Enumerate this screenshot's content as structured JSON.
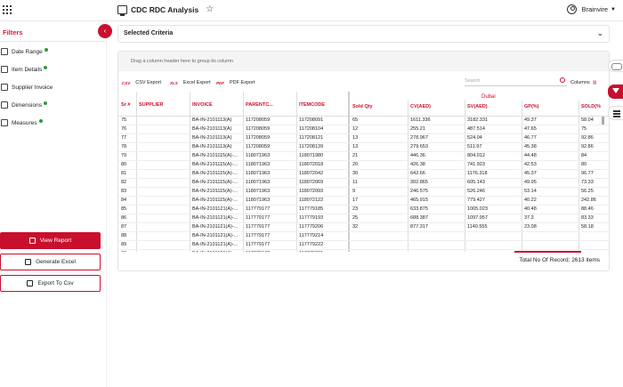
{
  "app": {
    "title": "CDC RDC Analysis",
    "user": "Brainvire"
  },
  "sidebar": {
    "title": "Filters",
    "items": [
      {
        "label": "Date Range",
        "dot": true
      },
      {
        "label": "Item Details",
        "dot": true
      },
      {
        "label": "Supplier Invoice",
        "dot": false
      },
      {
        "label": "Dimensions",
        "dot": true
      },
      {
        "label": "Measures",
        "dot": true
      }
    ],
    "view_report": "View Report",
    "generate_excel": "Generate Excel",
    "export_csv": "Export To Csv"
  },
  "criteria": {
    "label": "Selected Criteria"
  },
  "grid": {
    "group_hint": "Drag a column header here to group its column",
    "csv_export": "CSV Export",
    "excel_export": "Excel Export",
    "pdf_export": "PDF Export",
    "csv_fmt": "CSV",
    "xls_fmt": "XLS",
    "pdf_fmt": "PDF",
    "search_placeholder": "Search",
    "columns_label": "Columns",
    "group_header": "Dubai",
    "headers": [
      "Sr #",
      "SUPPLIER",
      "INVOICE",
      "PARENTC...",
      "ITEMCODE",
      "Sold Qty",
      "CV(AED)",
      "SV(AED)",
      "GP(%)",
      "SOLD(%"
    ],
    "rows": [
      [
        "75",
        "",
        "BA-IN-2101113(A)",
        "117208059",
        "117208091",
        "65",
        "1611.336",
        "3182.331",
        "49.37",
        "58.04"
      ],
      [
        "76",
        "",
        "BA-IN-2101113(A)",
        "117208059",
        "117208104",
        "12",
        "255.21",
        "487.514",
        "47.65",
        "75"
      ],
      [
        "77",
        "",
        "BA-IN-2101113(A)",
        "117208059",
        "117208121",
        "13",
        "278.967",
        "524.04",
        "46.77",
        "92.86"
      ],
      [
        "78",
        "",
        "BA-IN-2101113(A)",
        "117208059",
        "117208139",
        "13",
        "279.653",
        "511.97",
        "45.38",
        "92.86"
      ],
      [
        "79",
        "",
        "BA-IN-2101115(A)-...",
        "118071963",
        "118071980",
        "21",
        "446.36",
        "804.012",
        "44.48",
        "84"
      ],
      [
        "80",
        "",
        "BA-IN-2101115(A)-...",
        "118071963",
        "118072018",
        "20",
        "426.38",
        "741.923",
        "42.53",
        "80"
      ],
      [
        "81",
        "",
        "BA-IN-2101115(A)-...",
        "118071963",
        "118072042",
        "30",
        "642.66",
        "1176.318",
        "45.37",
        "96.77"
      ],
      [
        "82",
        "",
        "BA-IN-2101115(A)-...",
        "118071963",
        "118072069",
        "11",
        "302.865",
        "605.143",
        "49.95",
        "73.33"
      ],
      [
        "83",
        "",
        "BA-IN-2101115(A)-...",
        "118071963",
        "118072093",
        "9",
        "246.575",
        "526.246",
        "53.14",
        "56.25"
      ],
      [
        "84",
        "",
        "BA-IN-2101115(A)-...",
        "118071963",
        "118072122",
        "17",
        "465.915",
        "779.427",
        "40.22",
        "242.86"
      ],
      [
        "85",
        "",
        "BA-IN-2101121(A)-...",
        "117779177",
        "117779185",
        "23",
        "633.875",
        "1065.023",
        "40.48",
        "88.46"
      ],
      [
        "86",
        "",
        "BA-IN-2101121(A)-...",
        "117779177",
        "117779193",
        "25",
        "688.387",
        "1097.957",
        "37.3",
        "83.33"
      ],
      [
        "87",
        "",
        "BA-IN-2101121(A)-...",
        "117779177",
        "117779206",
        "32",
        "877.317",
        "1140.555",
        "23.08",
        "58.18"
      ],
      [
        "88",
        "",
        "BA-IN-2101121(A)-...",
        "117779177",
        "117779214",
        "",
        "",
        "",
        "",
        ""
      ],
      [
        "89",
        "",
        "BA-IN-2101121(A)-...",
        "117779177",
        "117779222",
        "",
        "",
        "",
        "",
        ""
      ],
      [
        "90",
        "",
        "BA-IN-2101121(A)-...",
        "117779177",
        "117779231",
        "",
        "",
        "",
        "",
        ""
      ]
    ],
    "total": "Total No Of Record: 2613 items"
  },
  "icons": [
    "apps-grid-icon",
    "app-monitor-icon",
    "star-icon",
    "user-icon",
    "chevron-left-icon",
    "chevron-down-icon",
    "toggle-icon",
    "filter-icon",
    "list-icon"
  ],
  "colors": {
    "accent": "#c8102e",
    "dot": "#2e9a3a"
  }
}
